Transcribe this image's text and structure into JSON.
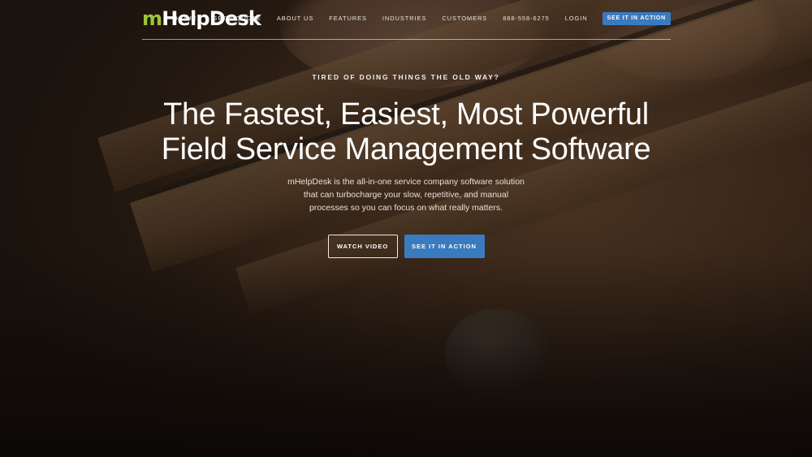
{
  "brand": {
    "logo_prefix": "m",
    "logo_rest": "HelpDesk",
    "accent": "#9bc43b"
  },
  "nav": {
    "items": [
      "HOME",
      "GET A QUOTE",
      "ABOUT US",
      "FEATURES",
      "INDUSTRIES",
      "CUSTOMERS",
      "888-558-6275",
      "LOGIN"
    ],
    "cta": "SEE IT IN ACTION"
  },
  "hero": {
    "eyebrow": "TIRED OF DOING THINGS THE OLD WAY?",
    "title_line1": "The Fastest, Easiest, Most Powerful",
    "title_line2": "Field Service Management Software",
    "description": "mHelpDesk is the all-in-one service company software solution that can turbocharge your slow, repetitive, and manual processes so you can focus on what really matters.",
    "watch_video": "WATCH VIDEO",
    "see_action": "SEE IT IN ACTION"
  },
  "colors": {
    "button_blue": "#3a7bbf",
    "logo_green": "#9bc43b"
  }
}
